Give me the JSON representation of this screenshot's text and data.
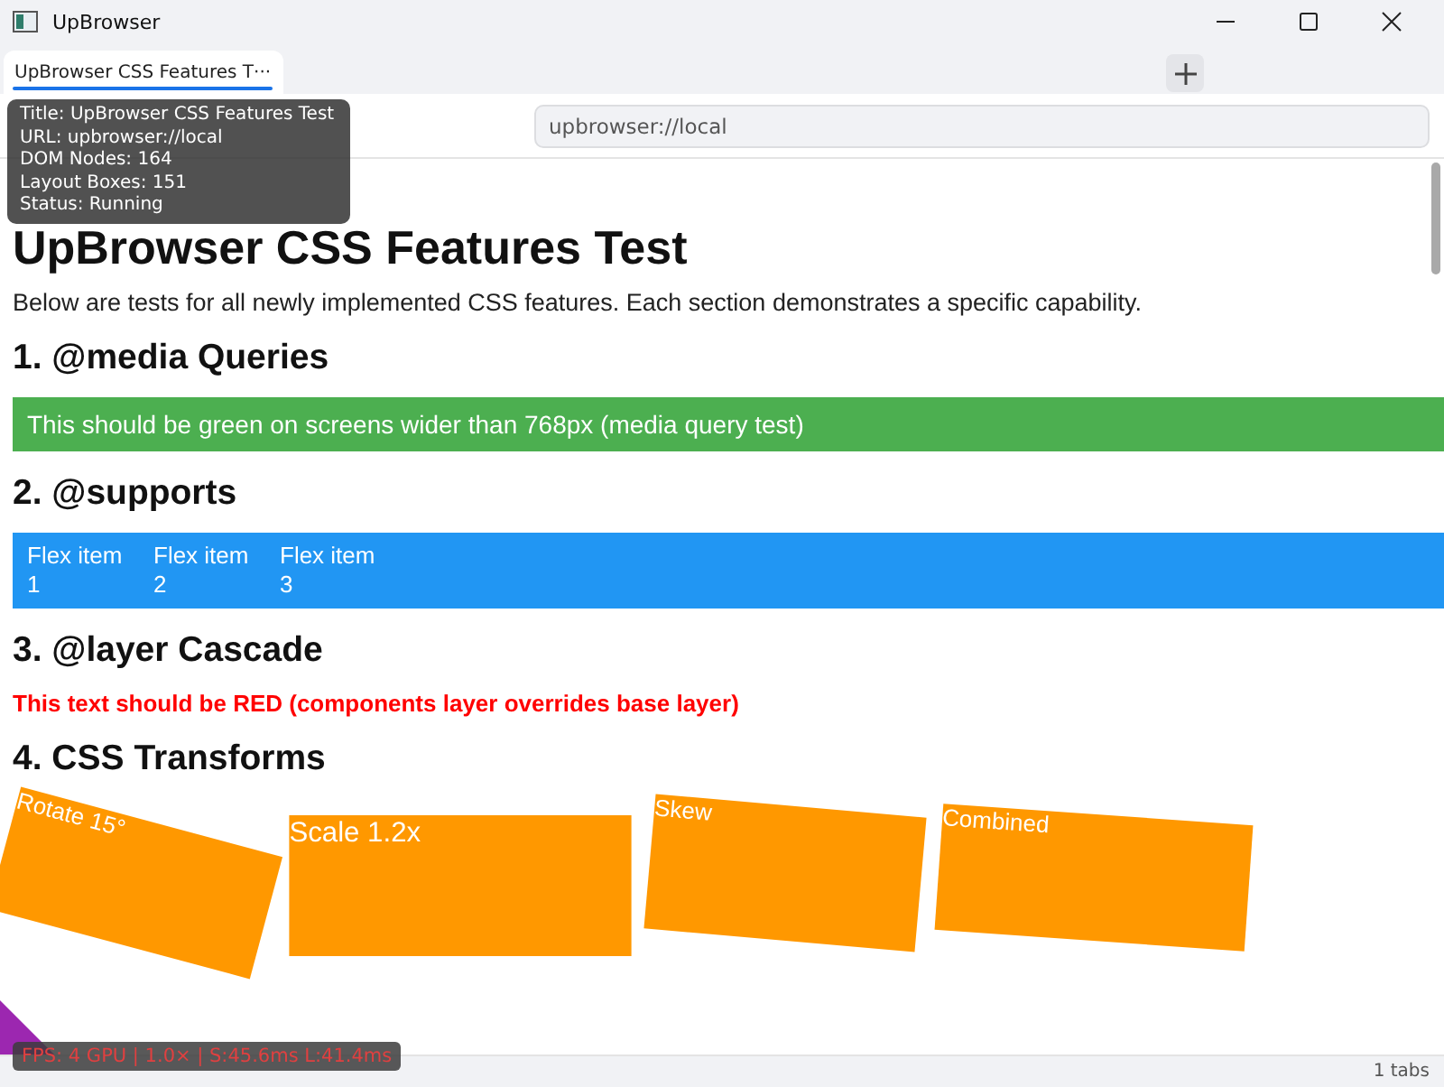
{
  "window": {
    "title": "UpBrowser"
  },
  "tabs": [
    {
      "label": "UpBrowser CSS Features T···",
      "selected": true
    }
  ],
  "address_bar": {
    "value": "upbrowser://local"
  },
  "tooltip": {
    "lines": [
      "Title: UpBrowser CSS Features Test",
      "URL: upbrowser://local",
      "DOM Nodes: 164",
      "Layout Boxes: 151",
      "Status: Running"
    ]
  },
  "page": {
    "heading": "UpBrowser CSS Features Test",
    "intro": "Below are tests for all newly implemented CSS features. Each section demonstrates a specific capability.",
    "sections": [
      {
        "kind": "banner",
        "title": "1. @media Queries",
        "text": "This should be green on screens wider than 768px (media query test)",
        "color": "#4caf50"
      },
      {
        "kind": "flex",
        "title": "2. @supports",
        "items": [
          "Flex item 1",
          "Flex item 2",
          "Flex item 3"
        ],
        "color": "#2196f3"
      },
      {
        "kind": "note",
        "title": "3. @layer Cascade",
        "text": "This text should be RED (components layer overrides base layer)",
        "color": "#ff0000"
      },
      {
        "kind": "transforms",
        "title": "4. CSS Transforms",
        "boxes": [
          {
            "kind": "rotate",
            "label": "Rotate 15°"
          },
          {
            "kind": "scale",
            "label": "Scale 1.2x"
          },
          {
            "kind": "skew",
            "label": "Skew"
          },
          {
            "kind": "combined",
            "label": "Combined"
          }
        ]
      }
    ]
  },
  "perf_overlay": {
    "text": "FPS: 4 GPU | 1.0× | S:45.6ms L:41.4ms"
  },
  "status_bar": {
    "tab_count": "1 tabs"
  }
}
